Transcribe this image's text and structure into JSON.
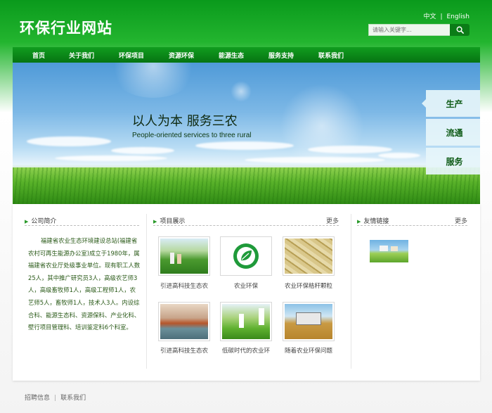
{
  "site": {
    "title": "环保行业网站",
    "lang_cn": "中文",
    "lang_sep": "|",
    "lang_en": "English",
    "search_placeholder": "请输入关键字...",
    "search_icon": "search-icon"
  },
  "nav": {
    "items": [
      "首页",
      "关于我们",
      "环保项目",
      "资源环保",
      "能源生态",
      "服务支持",
      "联系我们"
    ]
  },
  "banner": {
    "slogan_cn": "以人为本 服务三农",
    "slogan_en": "People-oriented services to three rural",
    "tabs": [
      "生产",
      "流通",
      "服务"
    ]
  },
  "about": {
    "title": "公司简介",
    "text": "福建省农业生态环境建设总站(福建省农村可再生能源办公室)成立于1980年，属福建省农业厅处级事业单位。现有职工人数25人，其中推广研究员3人，高级农艺师3人，高级畜牧师1人，高级工程师1人，农艺师5人，畜牧师1人，技术人3人。内设综合科、能源生态科、资源保科、产业化科、壁行项目管理科、培训鉴定科6个科室。"
  },
  "projects": {
    "title": "项目展示",
    "more": "更多",
    "items": [
      {
        "label": "引进高科技生态农"
      },
      {
        "label": "农业环保"
      },
      {
        "label": "农业环保秸秆颗粒"
      },
      {
        "label": "引进高科技生态农"
      },
      {
        "label": "低碳时代的农业环"
      },
      {
        "label": "随着农业环保问题"
      }
    ]
  },
  "links": {
    "title": "友情链接",
    "more": "更多"
  },
  "footer": {
    "link1": "招聘信息",
    "sep": "|",
    "link2": "联系我们"
  },
  "colors": {
    "brand_green": "#0a9a1c",
    "nav_green": "#067412",
    "text_green": "#2a5a18"
  }
}
